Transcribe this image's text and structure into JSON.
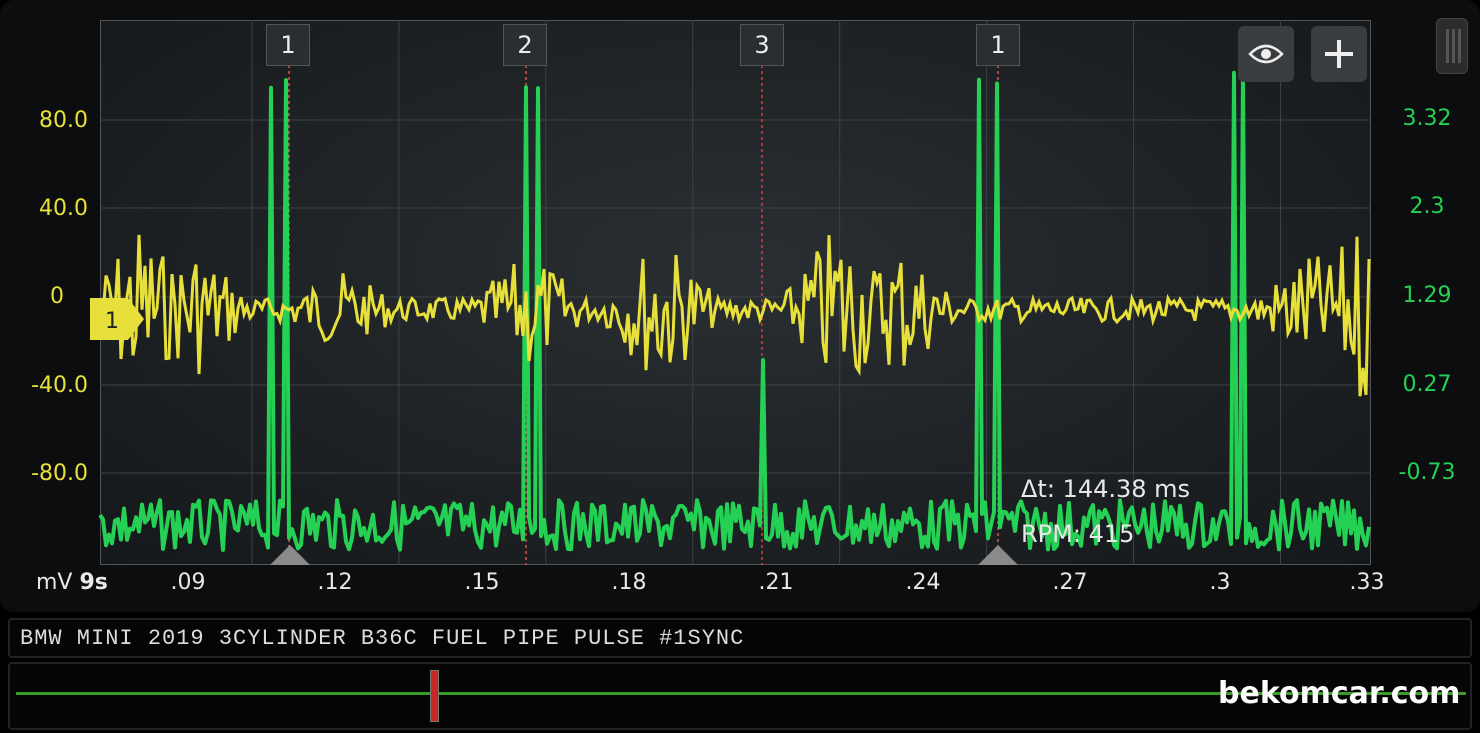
{
  "app": {
    "left_axis_unit": "mV",
    "timebase": "9s",
    "left_axis_ticks": [
      "80.0",
      "40.0",
      "0",
      "-40.0",
      "-80.0"
    ],
    "right_axis_ticks": [
      "3.32",
      "2.3",
      "1.29",
      "0.27",
      "-0.73"
    ],
    "x_axis_ticks": [
      ".09",
      ".12",
      ".15",
      ".18",
      ".21",
      ".24",
      ".27",
      ".3",
      ".33"
    ],
    "cylinder_markers": [
      "1",
      "2",
      "3",
      "1"
    ],
    "channel_flag": "1",
    "measurement": {
      "delta_t": "Δt: 144.38 ms",
      "rpm": "RPM: 415"
    },
    "buttons": {
      "eye": "eye-icon",
      "add": "plus-icon"
    },
    "title": "BMW MINI 2019 3CYLINDER B36C FUEL PIPE PULSE #1SYNC",
    "watermark": "bekomcar.com",
    "colors": {
      "ch_a": "#e8e03a",
      "ch_b": "#25d154",
      "cursor": "#c62828"
    }
  }
}
